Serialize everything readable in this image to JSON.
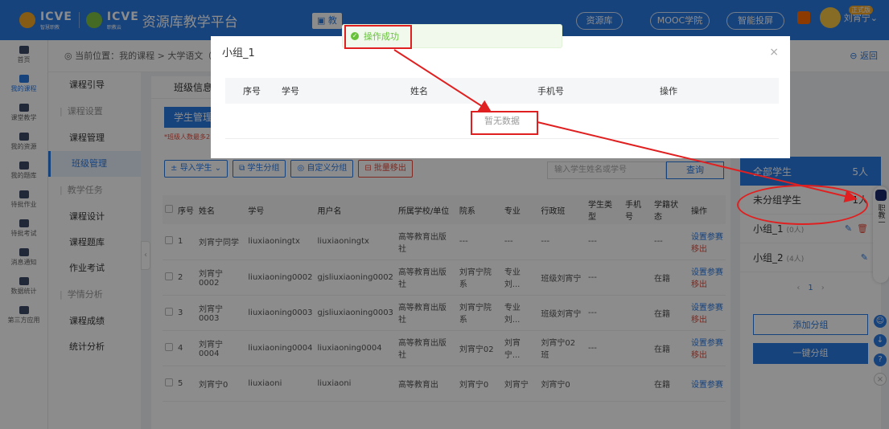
{
  "header": {
    "brand1": "ICVE",
    "brand1_sub": "智慧职教",
    "brand2": "ICVE",
    "brand2_sub": "职教云",
    "title": "资源库教学平台",
    "active_tab": "教",
    "nav_pills": [
      "资源库",
      "MOOC学院",
      "智能投屏"
    ],
    "user_name": "刘宵宁",
    "user_badge": "正式版"
  },
  "rail": {
    "items": [
      "首页",
      "我的课程",
      "课堂教学",
      "我的资源",
      "我的题库",
      "待批作业",
      "待批考试",
      "消息通知",
      "数据统计",
      "第三方应用"
    ]
  },
  "breadcrumb": {
    "text": "当前位置：我的课程 > 大学语文（2P",
    "back_label": "返回"
  },
  "sidebar": {
    "items": [
      {
        "type": "item",
        "label": "课程引导"
      },
      {
        "type": "group",
        "label": "课程设置"
      },
      {
        "type": "item",
        "label": "课程管理"
      },
      {
        "type": "item",
        "label": "班级管理",
        "active": true
      },
      {
        "type": "group",
        "label": "教学任务"
      },
      {
        "type": "item",
        "label": "课程设计"
      },
      {
        "type": "item",
        "label": "课程题库"
      },
      {
        "type": "item",
        "label": "作业考试"
      },
      {
        "type": "group",
        "label": "学情分析"
      },
      {
        "type": "item",
        "label": "课程成绩"
      },
      {
        "type": "item",
        "label": "统计分析"
      }
    ]
  },
  "main": {
    "tab": "班级信息",
    "subtab": "学生管理",
    "hint": "*班级人数最多2",
    "toolbar": {
      "import": "导入学生",
      "group": "学生分组",
      "custom_group": "自定义分组",
      "batch_remove": "批量移出"
    },
    "search_placeholder": "输入学生姓名或学号",
    "query_label": "查询",
    "columns": [
      "序号",
      "姓名",
      "学号",
      "用户名",
      "所属学校/单位",
      "院系",
      "专业",
      "行政班",
      "学生类型",
      "手机号",
      "学籍状态",
      "操作"
    ],
    "rows": [
      {
        "no": "1",
        "name": "刘宵宁同学",
        "sid": "liuxiaoningtx",
        "user": "liuxiaoningtx",
        "school": "高等教育出版社",
        "dept": "---",
        "major": "---",
        "cls": "---",
        "type": "---",
        "phone": "",
        "status": "---",
        "op1": "设置参赛",
        "op2": "移出"
      },
      {
        "no": "2",
        "name": "刘宵宁0002",
        "sid": "liuxiaoning0002",
        "user": "gjsliuxiaoning0002",
        "school": "高等教育出版社",
        "dept": "刘宵宁院系",
        "major": "专业刘...",
        "cls": "班级刘宵宁",
        "type": "---",
        "phone": "",
        "status": "在籍",
        "op1": "设置参赛",
        "op2": "移出"
      },
      {
        "no": "3",
        "name": "刘宵宁0003",
        "sid": "liuxiaoning0003",
        "user": "gjsliuxiaoning0003",
        "school": "高等教育出版社",
        "dept": "刘宵宁院系",
        "major": "专业刘...",
        "cls": "班级刘宵宁",
        "type": "---",
        "phone": "",
        "status": "在籍",
        "op1": "设置参赛",
        "op2": "移出"
      },
      {
        "no": "4",
        "name": "刘宵宁0004",
        "sid": "liuxiaoning0004",
        "user": "liuxiaoning0004",
        "school": "高等教育出版社",
        "dept": "刘宵宁02",
        "major": "刘宵宁...",
        "cls": "刘宵宁02班",
        "type": "---",
        "phone": "",
        "status": "在籍",
        "op1": "设置参赛",
        "op2": "移出"
      },
      {
        "no": "5",
        "name": "刘宵宁0",
        "sid": "liuxiaoni",
        "user": "liuxiaoni",
        "school": "高等教育出",
        "dept": "刘宵宁0",
        "major": "刘宵宁",
        "cls": "刘宵宁0",
        "type": "",
        "phone": "",
        "status": "在籍",
        "op1": "设置参赛",
        "op2": ""
      }
    ]
  },
  "groups": {
    "all_label": "全部学生",
    "all_count": "5人",
    "ungrouped_label": "未分组学生",
    "ungrouped_count": "1人",
    "list": [
      {
        "name": "小组_1",
        "count": "(0人)"
      },
      {
        "name": "小组_2",
        "count": "(4人)"
      }
    ],
    "page": "1",
    "add_label": "添加分组",
    "auto_label": "一键分组"
  },
  "float_widget": {
    "text": "职教一"
  },
  "modal": {
    "title": "小组_1",
    "columns": [
      "序号",
      "学号",
      "姓名",
      "手机号",
      "操作"
    ],
    "empty_text": "暂无数据"
  },
  "toast": {
    "text": "操作成功"
  }
}
